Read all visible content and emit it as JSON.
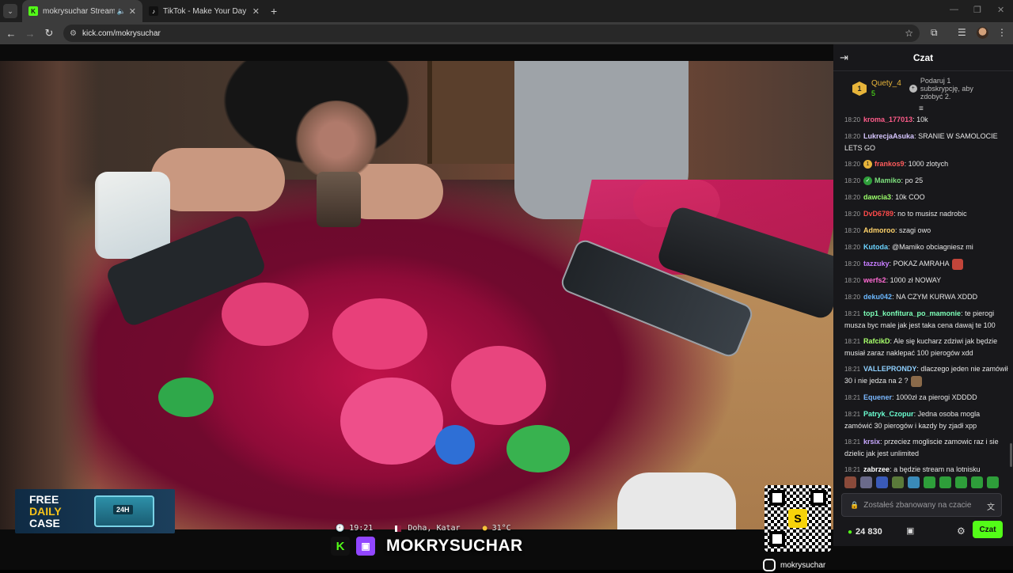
{
  "browser": {
    "tabs": [
      {
        "title": "mokrysuchar Stream - Watc",
        "active": true,
        "favicon": "K"
      },
      {
        "title": "TikTok - Make Your Day",
        "active": false,
        "favicon": "♪"
      }
    ],
    "url": "kick.com/mokrysuchar"
  },
  "stream": {
    "time": "19:21",
    "location": "Doha, Katar",
    "temperature": "31°C",
    "name": "MOKRYSUCHAR",
    "handle": "mokrysuchar",
    "qr_logo": "S",
    "promo": {
      "line1": "FREE",
      "line2": "DAILY",
      "line3": "CASE",
      "box_label": "24H"
    }
  },
  "chat": {
    "title": "Czat",
    "pinned": {
      "rank": "1",
      "user": "Quety_4",
      "count": "5",
      "gift_text": "Podaruj 1 subskrypcję, aby zdobyć 2."
    },
    "messages": [
      {
        "time": "18:20",
        "user": "kroma_177013",
        "color": "#ff5c8a",
        "text": "10k",
        "badge": ""
      },
      {
        "time": "18:20",
        "user": "LukrecjaAsuka",
        "color": "#d7c6ff",
        "text": "SRANIE W SAMOLOCIE LETS GO",
        "badge": ""
      },
      {
        "time": "18:20",
        "user": "frankos9",
        "color": "#ff5c5c",
        "text": "1000 zlotych",
        "badge": "1"
      },
      {
        "time": "18:20",
        "user": "Mamiko",
        "color": "#7de07d",
        "text": "po 25",
        "badge": "✓"
      },
      {
        "time": "18:20",
        "user": "dawcia3",
        "color": "#9cff6b",
        "text": "10k COO",
        "badge": ""
      },
      {
        "time": "18:20",
        "user": "DvD6789",
        "color": "#ff4b4b",
        "text": "no to musisz nadrobic",
        "badge": ""
      },
      {
        "time": "18:20",
        "user": "Admoroo",
        "color": "#ffd36b",
        "text": "szagi owo",
        "badge": ""
      },
      {
        "time": "18:20",
        "user": "Kutoda",
        "color": "#6bd3ff",
        "text": "@Mamiko obciagniesz mi",
        "badge": ""
      },
      {
        "time": "18:20",
        "user": "tazzuky",
        "color": "#c77dff",
        "text": "POKAZ AMRAHA",
        "badge": "",
        "emote": "#c2453a"
      },
      {
        "time": "18:20",
        "user": "werfs2",
        "color": "#ff6bd3",
        "text": "1000 zł NOWAY",
        "badge": ""
      },
      {
        "time": "18:20",
        "user": "deku042",
        "color": "#6bb8ff",
        "text": "NA CZYM KURWA XDDD",
        "badge": ""
      },
      {
        "time": "18:21",
        "user": "top1_konfitura_po_mamonie",
        "color": "#7dffb8",
        "text": "te pierogi musza byc male jak jest taka cena dawaj te 100",
        "badge": ""
      },
      {
        "time": "18:21",
        "user": "RafcikD",
        "color": "#a8ff6b",
        "text": "Ale się kucharz zdziwi jak będzie musiał zaraz naklepać 100 pierogów xdd",
        "badge": ""
      },
      {
        "time": "18:21",
        "user": "VALLEPRONDY",
        "color": "#8fd0ff",
        "text": "dlaczego jeden nie zamówił 30 i nie jedza na 2 ?",
        "badge": "",
        "emote": "#8a6a4a"
      },
      {
        "time": "18:21",
        "user": "Equener",
        "color": "#7ab8ff",
        "text": "1000zł za pierogi XDDDD",
        "badge": ""
      },
      {
        "time": "18:21",
        "user": "Patryk_Czopur",
        "color": "#6bffd1",
        "text": "Jedna osoba mogla zamówić 30 pierogów i kazdy by zjadł xpp",
        "badge": ""
      },
      {
        "time": "18:21",
        "user": "krsix",
        "color": "#c8a8ff",
        "text": "przeciez mogliscie zamowic raz i sie dzielic jak jest unlimited",
        "badge": ""
      },
      {
        "time": "18:21",
        "user": "zabrzee",
        "color": "#ffffff",
        "text": "a będzie stream na lotnisku",
        "badge": ""
      }
    ],
    "emotes": [
      "#8a4a3a",
      "#6a6a8a",
      "#3a5ab8",
      "#5a7a3a",
      "#3a8ab8",
      "#2e9e3a",
      "#2e9e3a",
      "#2e9e3a",
      "#2e9e3a",
      "#2e9e3a"
    ],
    "input_placeholder": "Zostałeś zbanowany na czacie",
    "points": "24 830",
    "send_label": "Czat"
  },
  "colors": {
    "kick_green": "#53fc18",
    "twitch_purple": "#9146ff",
    "chat_bg": "#18181b"
  }
}
